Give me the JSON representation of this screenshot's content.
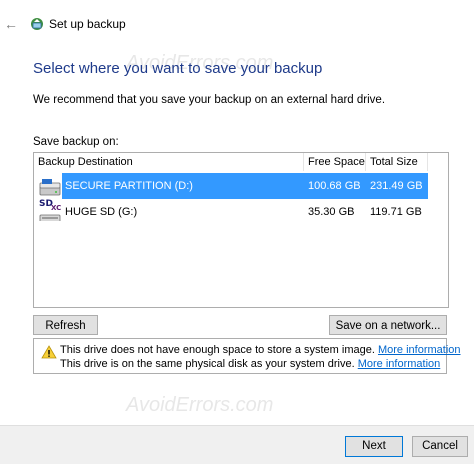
{
  "window": {
    "title": "Set up backup"
  },
  "main": {
    "heading": "Select where you want to save your backup",
    "recommendation": "We recommend that you save your backup on an external hard drive.",
    "save_label": "Save backup on:"
  },
  "list": {
    "columns": [
      "Backup Destination",
      "Free Space",
      "Total Size"
    ],
    "rows": [
      {
        "name": "SECURE PARTITION (D:)",
        "free": "100.68 GB",
        "total": "231.49 GB"
      },
      {
        "name": "HUGE SD (G:)",
        "free": "35.30 GB",
        "total": "119.71 GB"
      }
    ],
    "sd_icon_text": "SD",
    "sdxc_icon_text": "XC"
  },
  "buttons": {
    "refresh": "Refresh",
    "save_on_network": "Save on a network...",
    "next": "Next",
    "cancel": "Cancel"
  },
  "warnings": {
    "line1": "This drive does not have enough space to store a system image.",
    "line1_link": "More information",
    "line2": "This drive is on the same physical disk as your system drive.",
    "line2_link": "More information"
  },
  "watermark": "AvoidErrors.com",
  "colors": {
    "heading": "#1e3a8a",
    "selection": "#3399ff",
    "link": "#0066cc",
    "footer": "#f0f0f0"
  }
}
